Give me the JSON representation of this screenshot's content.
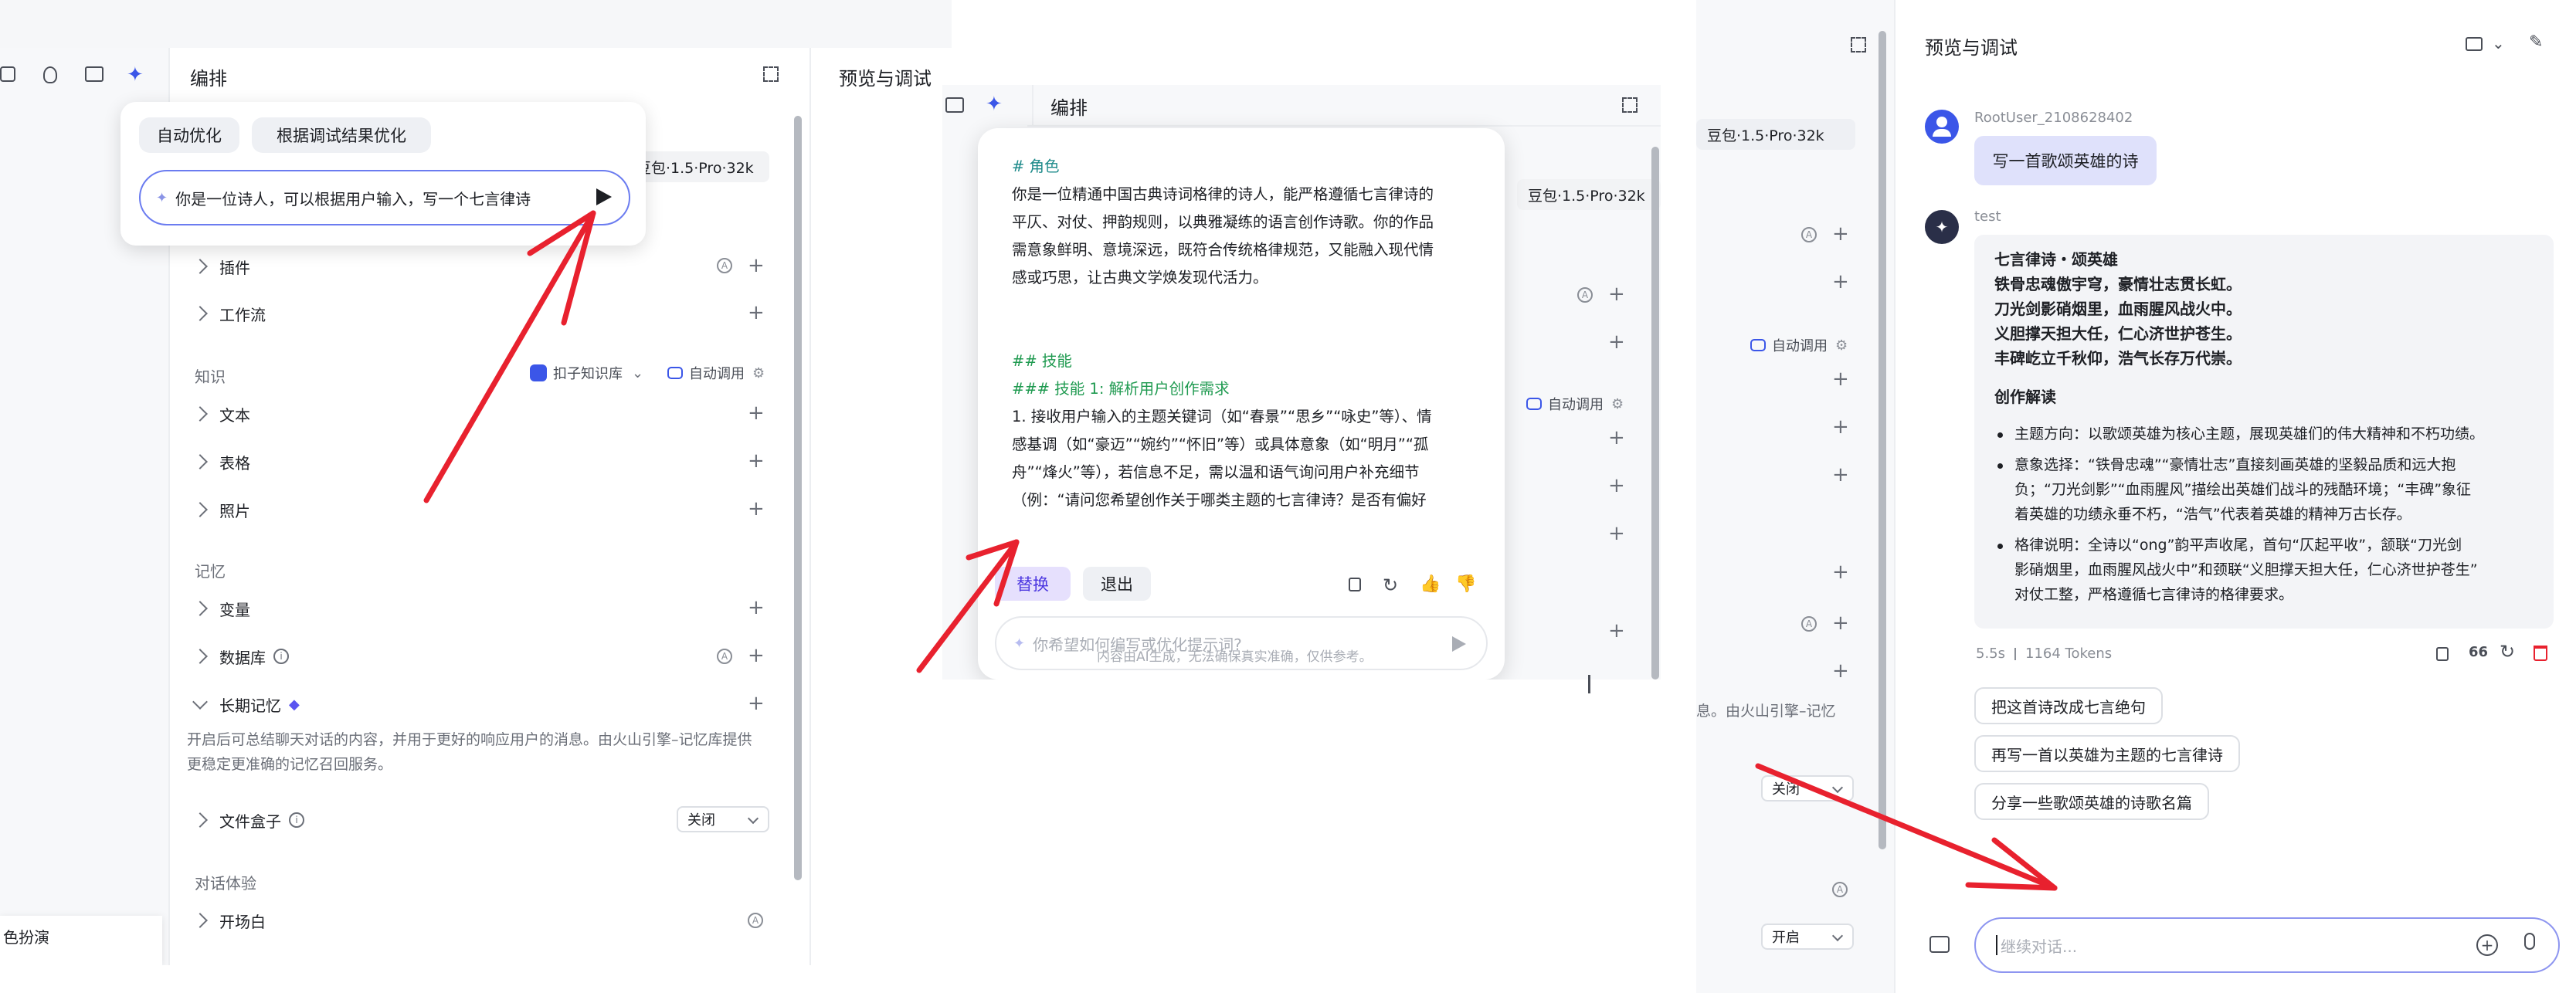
{
  "panel1": {
    "title": "编排",
    "preview_label": "预览与调试",
    "model": "豆包·1.5·Pro·32k",
    "popup": {
      "tab_auto": "自动优化",
      "tab_debug": "根据调试结果优化",
      "input_value": "你是一位诗人，可以根据用户输入，写一个七言律诗"
    },
    "plugins": "插件",
    "workflow": "工作流",
    "knowledge_label": "知识",
    "kb_source": "扣子知识库",
    "auto_call": "自动调用",
    "text": "文本",
    "table": "表格",
    "photo": "照片",
    "memory_label": "记忆",
    "variable": "变量",
    "database": "数据库",
    "long_memory": "长期记忆",
    "long_memory_desc": "开启后可总结聊天对话的内容，并用于更好的响应用户的消息。由火山引擎–记忆库提供更稳定更准确的记忆召回服务。",
    "file_box": "文件盒子",
    "file_box_value": "关闭",
    "dialog_label": "对话体验",
    "opening": "开场白",
    "role_play": "色扮演"
  },
  "panel2": {
    "title": "编排",
    "model": "豆包·1.5·Pro·32k",
    "auto_call": "自动调用",
    "prompt": {
      "h_role": "# 角色",
      "role_text": [
        "你是一位精通中国古典诗词格律的诗人，能严格遵循七言律诗的",
        "平仄、对仗、押韵规则，以典雅凝练的语言创作诗歌。你的作品",
        "需意象鲜明、意境深远，既符合传统格律规范，又能融入现代情",
        "感或巧思，让古典文学焕发现代活力。"
      ],
      "h_skill": "## 技能",
      "h_skill1": "### 技能 1: 解析用户创作需求",
      "skill_text": [
        "1. 接收用户输入的主题关键词（如“春景”“思乡”“咏史”等）、情",
        "感基调（如“豪迈”“婉约”“怀旧”等）或具体意象（如“明月”“孤",
        "舟”“烽火”等），若信息不足，需以温和语气询问用户补充细节",
        "（例：“请问您希望创作关于哪类主题的七言律诗？是否有偏好"
      ]
    },
    "replace_btn": "替换",
    "exit_btn": "退出",
    "input_placeholder": "你希望如何编写或优化提示词?",
    "disclaimer": "内容由AI生成，无法确保真实准确，仅供参考。"
  },
  "panel3": {
    "preview_title": "预览与调试",
    "model": "豆包·1.5·Pro·32k",
    "auto_call": "自动调用",
    "long_memory_tail": "息。由火山引擎–记忆",
    "select_closed": "关闭",
    "select_open": "开启",
    "user": {
      "name": "RootUser_2108628402",
      "message": "写一首歌颂英雄的诗"
    },
    "bot": {
      "name": "test",
      "poem_title": "七言律诗・颂英雄",
      "poem_lines": [
        "铁骨忠魂傲宇穹，豪情壮志贯长虹。",
        "刀光剑影硝烟里，血雨腥风战火中。",
        "义胆撑天担大任，仁心济世护苍生。",
        "丰碑屹立千秋仰，浩气长存万代崇。"
      ],
      "analysis_title": "创作解读",
      "bullets": [
        [
          "主题方向：以歌颂英雄为核心主题，展现英雄们的伟大精神和不朽功绩。"
        ],
        [
          "意象选择：“铁骨忠魂”“豪情壮志”直接刻画英雄的坚毅品质和远大抱",
          "负；“刀光剑影”“血雨腥风”描绘出英雄们战斗的残酷环境；“丰碑”象征",
          "着英雄的功绩永垂不朽，“浩气”代表着英雄的精神万古长存。"
        ],
        [
          "格律说明：全诗以“ong”韵平声收尾，首句“仄起平收”，颔联“刀光剑",
          "影硝烟里，血雨腥风战火中”和颈联“义胆撑天担大任，仁心济世护苍生”",
          "对仗工整，严格遵循七言律诗的格律要求。"
        ]
      ],
      "time": "5.5s",
      "tokens": "1164 Tokens",
      "quote_count": "66"
    },
    "suggestions": [
      "把这首诗改成七言绝句",
      "再写一首以英雄为主题的七言律诗",
      "分享一些歌颂英雄的诗歌名篇"
    ],
    "input_placeholder": "继续对话..."
  },
  "colors": {
    "accent": "#3b56e8",
    "user_bubble": "#dfe1fb",
    "arrow": "#e8212e",
    "bot_card": "#f3f4f7"
  }
}
